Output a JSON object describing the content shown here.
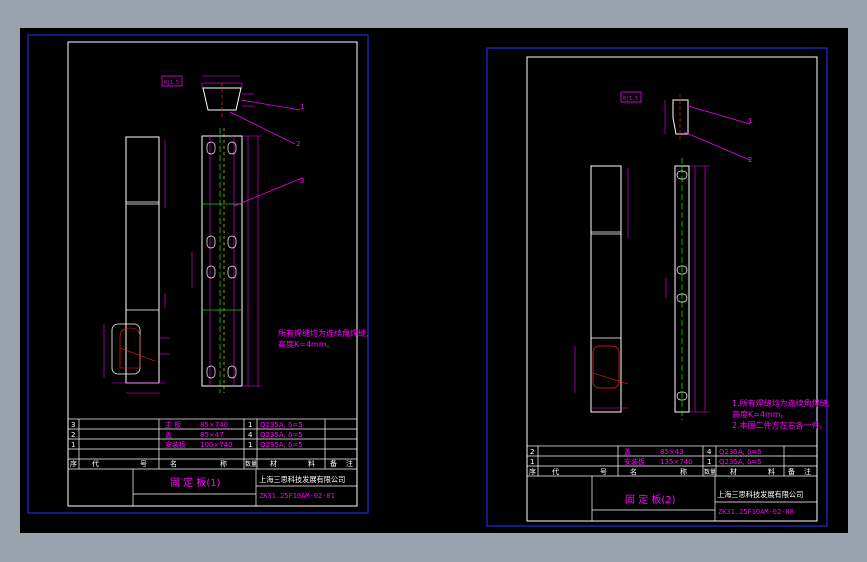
{
  "colors": {
    "background": "#000000",
    "frame_outer": "#3030ff",
    "frame_inner": "#ffffff",
    "title_lines": "#ffffff",
    "magenta": "#ff00ff",
    "green": "#00dd00",
    "yellow": "#ffff00",
    "red": "#ff2020",
    "white_text": "#ffffff"
  },
  "sheet1": {
    "note": "所有焊缝均为连续角焊缝,\n高度K=4mm。",
    "parts": [
      {
        "no": "3",
        "name": "主 板",
        "spec": "85×740",
        "qty": "1",
        "material": "Q235A, δ=5"
      },
      {
        "no": "2",
        "name": "盖",
        "spec": "85×47",
        "qty": "4",
        "material": "Q235A, δ=5"
      },
      {
        "no": "1",
        "name": "安装板",
        "spec": "100×740",
        "qty": "1",
        "material": "Q235A, δ=5"
      }
    ],
    "header": {
      "seq": "序",
      "code": "代",
      "code2": "号",
      "name": "名",
      "name2": "称",
      "qty": "数量",
      "material": "材",
      "material2": "料",
      "remark": "备",
      "remark2": "注"
    },
    "title": "固 定 板(1)",
    "company": "上海三思科技发展有限公司",
    "drawing_no": "ZK31.25F10AM-02-01",
    "balloons": [
      "1",
      "2",
      "3"
    ],
    "flag": "0|1.5"
  },
  "sheet2": {
    "note": "1.所有焊缝均为连续角焊缝,\n高度K=4mm。\n2.本图二件方左右各一件。",
    "parts": [
      {
        "no": "2",
        "name": "盖",
        "spec": "85×43",
        "qty": "4",
        "material": "Q235A, δ=5"
      },
      {
        "no": "1",
        "name": "安装板",
        "spec": "135×740",
        "qty": "1",
        "material": "Q235A, δ=5"
      }
    ],
    "header": {
      "seq": "序",
      "code": "代",
      "code2": "号",
      "name": "名",
      "name2": "称",
      "qty": "数量",
      "material": "材",
      "material2": "料",
      "remark": "备",
      "remark2": "注"
    },
    "title": "固 定 板(2)",
    "company": "上海三思科技发展有限公司",
    "drawing_no": "ZK31.25F10AM-02-08",
    "balloons": [
      "1",
      "2"
    ],
    "flag": "0|1.5"
  }
}
